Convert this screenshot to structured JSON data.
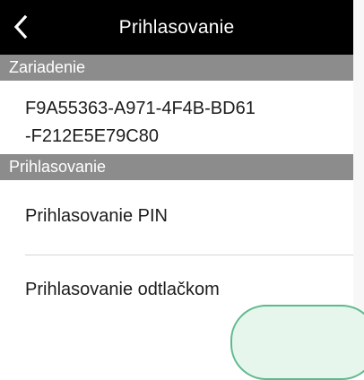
{
  "nav": {
    "title": "Prihlasovanie",
    "back_icon": "chevron-left-icon"
  },
  "sections": {
    "device_header": "Zariadenie",
    "device_id_line1": "F9A55363-A971-4F4B-BD61",
    "device_id_line2": "-F212E5E79C80",
    "login_header": "Prihlasovanie"
  },
  "items": {
    "pin_login": "Prihlasovanie PIN",
    "fingerprint_login": "Prihlasovanie odtlačkom"
  },
  "colors": {
    "nav_bg": "#000000",
    "section_bg": "#8c8c8c",
    "fab_border": "#5fb98d",
    "fab_fill": "#e6f6ed"
  }
}
